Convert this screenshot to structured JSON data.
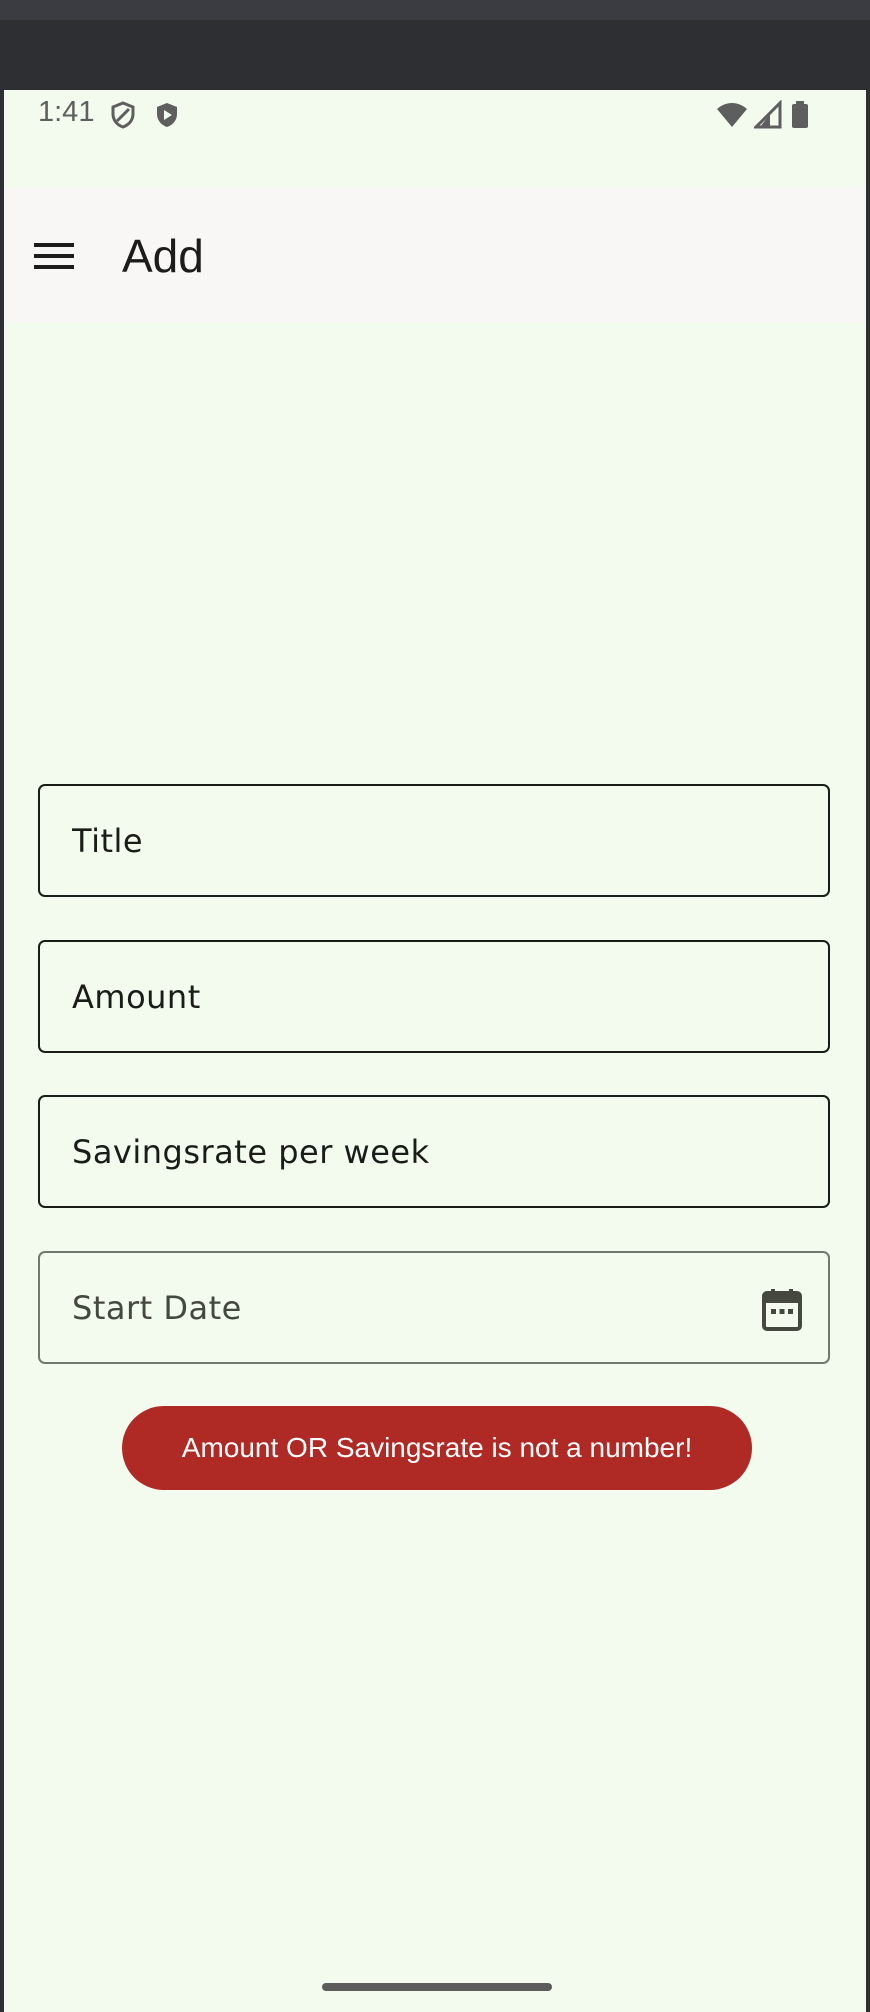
{
  "status_bar": {
    "time": "1:41",
    "left_icons": [
      "shield-icon",
      "play-protect-icon"
    ],
    "right_icons": [
      "wifi-icon",
      "cellular-icon",
      "battery-icon"
    ]
  },
  "app_bar": {
    "title": "Add",
    "menu_icon": "hamburger-menu-icon"
  },
  "form": {
    "title": {
      "value": "",
      "placeholder": "Title"
    },
    "amount": {
      "value": "",
      "placeholder": "Amount"
    },
    "savings_rate": {
      "value": "",
      "placeholder": "Savingsrate per week"
    },
    "start_date": {
      "value": "",
      "placeholder": "Start Date",
      "icon": "calendar-icon"
    }
  },
  "error_toast": {
    "message": "Amount OR Savingsrate is not a number!",
    "color": "#b02a25"
  },
  "colors": {
    "background": "#f3faee",
    "app_bar": "#f8f7f5",
    "field_border": "#1a1c18"
  }
}
